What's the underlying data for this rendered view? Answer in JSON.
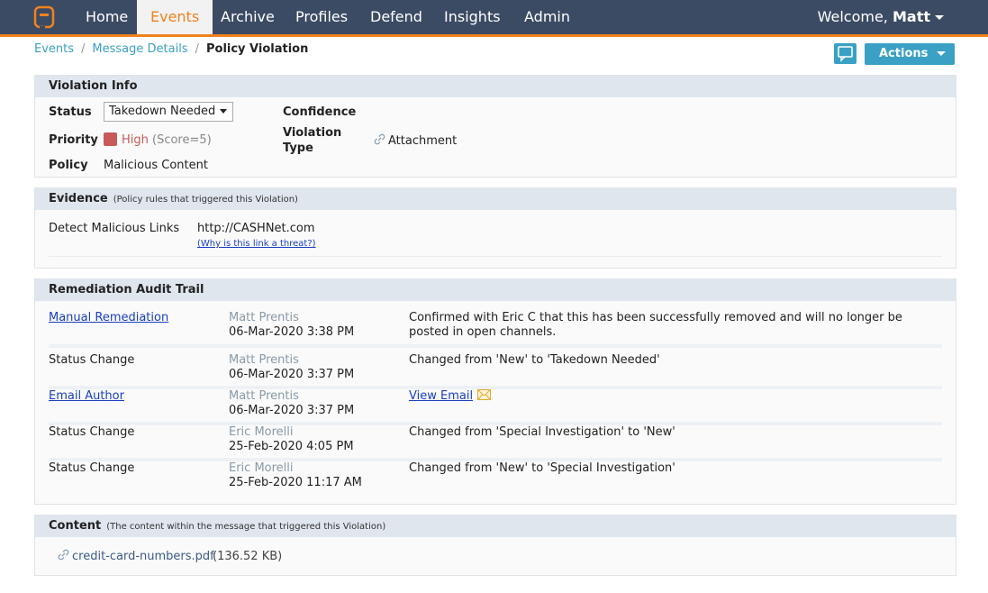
{
  "nav": {
    "items": [
      {
        "label": "Home"
      },
      {
        "label": "Events"
      },
      {
        "label": "Archive"
      },
      {
        "label": "Profiles"
      },
      {
        "label": "Defend"
      },
      {
        "label": "Insights"
      },
      {
        "label": "Admin"
      }
    ],
    "welcome_prefix": "Welcome,",
    "user": "Matt"
  },
  "breadcrumb": {
    "items": [
      "Events",
      "Message Details"
    ],
    "separator": "/",
    "current": "Policy Violation"
  },
  "toolbar": {
    "actions_label": "Actions"
  },
  "colors": {
    "nav_bg": "#3c4b64",
    "accent": "#f0821e",
    "button": "#3aa0c4",
    "priority_high": "#c85a5a"
  },
  "violation_info": {
    "title": "Violation Info",
    "status_label": "Status",
    "status_value": "Takedown Needed",
    "priority_label": "Priority",
    "priority_value": "High",
    "priority_score": "(Score=5)",
    "policy_label": "Policy",
    "policy_value": "Malicious Content",
    "confidence_label": "Confidence",
    "violation_type_label_1": "Violation",
    "violation_type_label_2": "Type",
    "violation_type_value": "Attachment"
  },
  "evidence": {
    "title": "Evidence",
    "subtitle": "(Policy rules that triggered this Violation)",
    "rule": "Detect Malicious Links",
    "value": "http://CASHNet.com",
    "why_link": "(Why is this link a threat?)"
  },
  "audit": {
    "title": "Remediation Audit Trail",
    "rows": [
      {
        "action": "Manual Remediation",
        "user": "Matt Prentis",
        "time": "06-Mar-2020 3:38 PM",
        "detail": "Confirmed with Eric C that this has been successfully removed and will no longer be",
        "detail2": "posted in open channels."
      },
      {
        "action": "Status Change",
        "user": "Matt Prentis",
        "time": "06-Mar-2020 3:37 PM",
        "detail": "Changed from 'New' to 'Takedown Needed'"
      },
      {
        "action": "Email Author",
        "user": "Matt Prentis",
        "time": "06-Mar-2020 3:37 PM",
        "detail": "View Email"
      },
      {
        "action": "Status Change",
        "user": "Eric Morelli",
        "time": "25-Feb-2020 4:05 PM",
        "detail": "Changed from 'Special Investigation' to 'New'"
      },
      {
        "action": "Status Change",
        "user": "Eric Morelli",
        "time": "25-Feb-2020 11:17 AM",
        "detail": "Changed from 'New' to 'Special Investigation'"
      }
    ]
  },
  "content": {
    "title": "Content",
    "subtitle": "(The content within the message that triggered this Violation)",
    "file_name": "credit-card-numbers.pdf",
    "file_size": "(136.52 KB)"
  }
}
